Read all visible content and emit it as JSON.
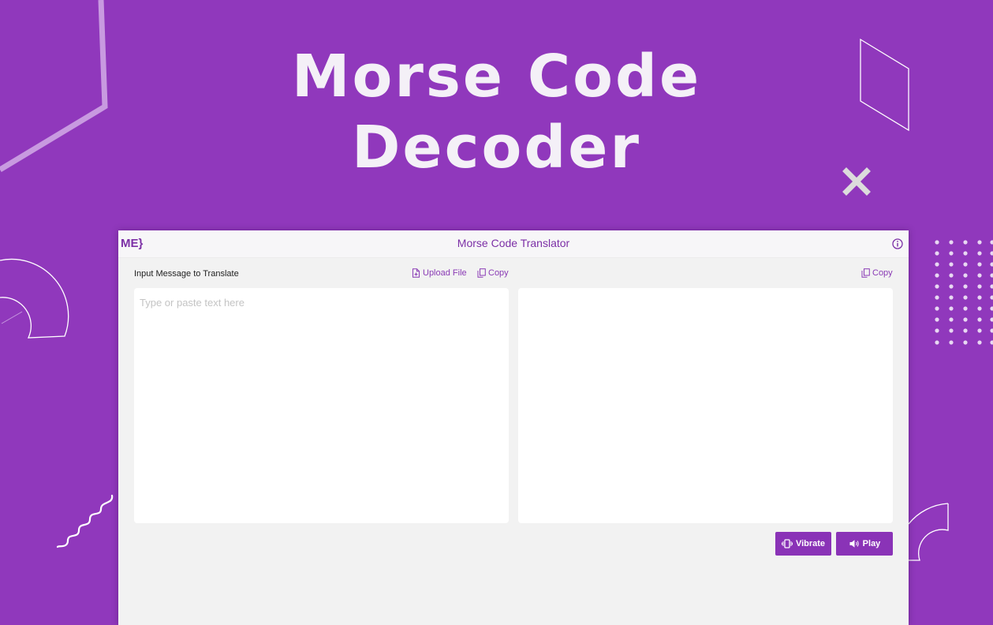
{
  "hero": {
    "title_line1": "Morse Code",
    "title_line2": "Decoder"
  },
  "window": {
    "logo_text": "ME}",
    "title": "Morse Code Translator"
  },
  "input_panel": {
    "label": "Input Message to Translate",
    "upload_label": "Upload File",
    "copy_label": "Copy",
    "placeholder": "Type or paste text here",
    "value": ""
  },
  "output_panel": {
    "copy_label": "Copy",
    "value": ""
  },
  "buttons": {
    "vibrate_label": "Vibrate",
    "play_label": "Play"
  },
  "colors": {
    "background": "#9038bc",
    "accent": "#8a33b7",
    "window_bg": "#f2f2f2"
  },
  "icons": [
    "info-icon",
    "file-icon",
    "copy-icon",
    "vibrate-icon",
    "speaker-icon",
    "close-icon"
  ]
}
